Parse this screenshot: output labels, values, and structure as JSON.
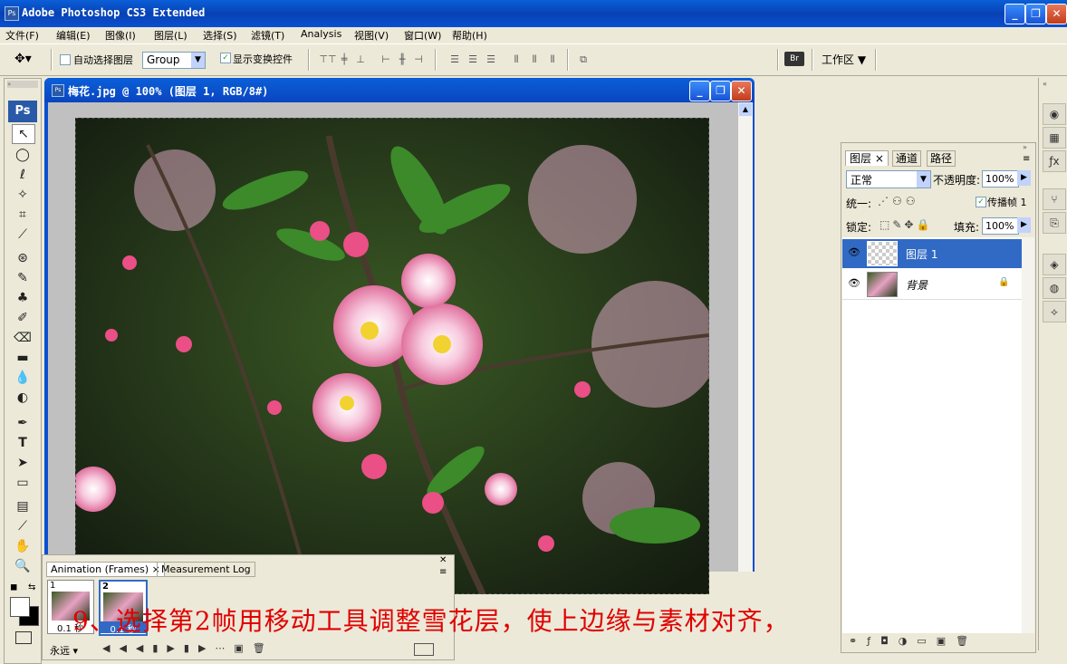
{
  "app": {
    "title": "Adobe Photoshop CS3 Extended",
    "ps_badge": "Ps"
  },
  "menu": [
    "文件(F)",
    "编辑(E)",
    "图像(I)",
    "图层(L)",
    "选择(S)",
    "滤镜(T)",
    "Analysis",
    "视图(V)",
    "窗口(W)",
    "帮助(H)"
  ],
  "options": {
    "auto_select_label": "自动选择图层",
    "auto_select_checked": false,
    "auto_select_value": "Group",
    "show_transform_label": "显示变换控件",
    "show_transform_checked": true,
    "workspace_label": "工作区"
  },
  "document": {
    "title": "梅花.jpg @ 100% (图层 1, RGB/8#)",
    "zoom": "100%"
  },
  "layers_panel": {
    "tabs": [
      "图层",
      "通道",
      "路径"
    ],
    "blend_mode": "正常",
    "opacity_label": "不透明度:",
    "opacity_value": "100%",
    "unify_label": "统一:",
    "propagate_label": "传播帧 1",
    "propagate_checked": true,
    "lock_label": "锁定:",
    "fill_label": "填充:",
    "fill_value": "100%",
    "layers": [
      {
        "name": "图层 1",
        "selected": true,
        "locked": false
      },
      {
        "name": "背景",
        "selected": false,
        "locked": true
      }
    ]
  },
  "animation_panel": {
    "tabs": [
      "Animation (Frames)",
      "Measurement Log"
    ],
    "frames": [
      {
        "number": "1",
        "delay": "0.1 秒"
      },
      {
        "number": "2",
        "delay": "0.1 秒",
        "selected": true
      }
    ],
    "loop": "永远"
  },
  "caption": "9、选择第2帧用移动工具调整雪花层，使上边缘与素材对齐，",
  "colors": {
    "titlebar": "#0842b4",
    "selected_layer": "#316ac5",
    "caption": "#e00000"
  },
  "icons": [
    "move-tool-icon",
    "marquee-icon",
    "lasso-icon",
    "magic-wand-icon",
    "crop-icon",
    "eyedropper-icon",
    "heal-icon",
    "brush-icon",
    "stamp-icon",
    "history-brush-icon",
    "eraser-icon",
    "gradient-icon",
    "blur-icon",
    "dodge-icon",
    "pen-icon",
    "type-icon",
    "path-select-icon",
    "shape-icon",
    "notes-icon",
    "eyedropper2-icon",
    "hand-icon",
    "zoom-icon"
  ]
}
